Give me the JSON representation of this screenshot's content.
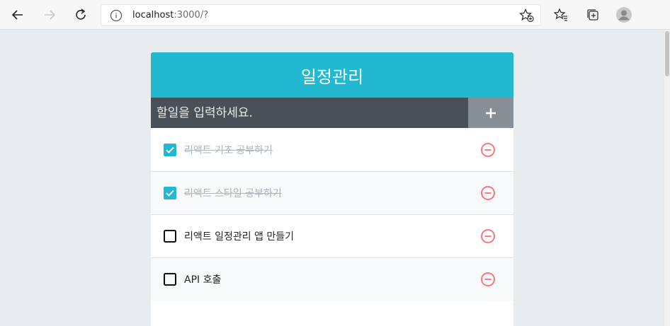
{
  "browser": {
    "url_host": "localhost",
    "url_rest": ":3000/?",
    "icons": [
      "back-icon",
      "forward-icon",
      "reload-icon",
      "info-icon",
      "add-favorite-icon",
      "favorites-icon",
      "collections-icon",
      "profile-icon"
    ]
  },
  "app": {
    "title": "일정관리",
    "input_placeholder": "할일을 입력하세요.",
    "colors": {
      "header": "#22b8cf",
      "insert_bg": "#495057",
      "add_btn": "#868e96",
      "check": "#22b8cf",
      "remove": "#ff6b6b"
    },
    "todos": [
      {
        "text": "리액트 기초 공부하기",
        "checked": true
      },
      {
        "text": "리액트 스타일 공부하기",
        "checked": true
      },
      {
        "text": "리액트 일정관리 앱 만들기",
        "checked": false
      },
      {
        "text": "API 호출",
        "checked": false
      }
    ]
  }
}
